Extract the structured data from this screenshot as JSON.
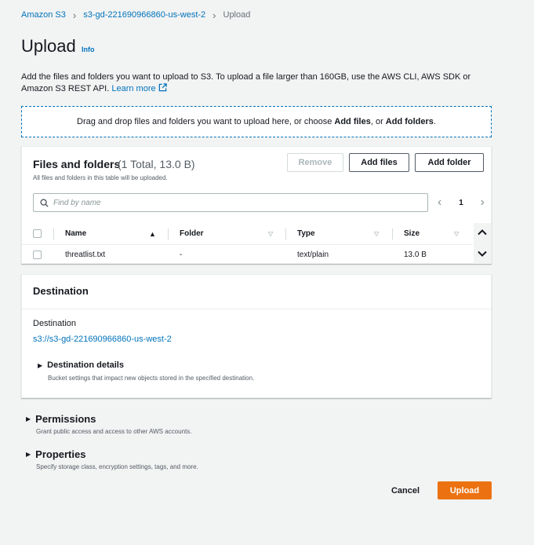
{
  "breadcrumb": {
    "items": [
      "Amazon S3",
      "s3-gd-221690966860-us-west-2",
      "Upload"
    ]
  },
  "page": {
    "title": "Upload",
    "info_label": "Info",
    "description": "Add the files and folders you want to upload to S3. To upload a file larger than 160GB, use the AWS CLI, AWS SDK or Amazon S3 REST API.",
    "learn_more": "Learn more"
  },
  "dropzone": {
    "text_prefix": "Drag and drop files and folders you want to upload here, or choose ",
    "add_files": "Add files",
    "text_mid": ", or ",
    "add_folders": "Add folders",
    "text_suffix": "."
  },
  "files_panel": {
    "title": "Files and folders",
    "count": "(1 Total, 13.0 B)",
    "subtitle": "All files and folders in this table will be uploaded.",
    "remove_label": "Remove",
    "add_files_label": "Add files",
    "add_folder_label": "Add folder",
    "search_placeholder": "Find by name",
    "page_number": "1",
    "columns": [
      "Name",
      "Folder",
      "Type",
      "Size"
    ],
    "rows": [
      {
        "name": "threatlist.txt",
        "folder": "-",
        "type": "text/plain",
        "size": "13.0 B"
      }
    ]
  },
  "destination": {
    "section_title": "Destination",
    "label": "Destination",
    "link": "s3://s3-gd-221690966860-us-west-2",
    "details_title": "Destination details",
    "details_sub": "Bucket settings that impact new objects stored in the specified destination."
  },
  "permissions": {
    "title": "Permissions",
    "sub": "Grant public access and access to other AWS accounts."
  },
  "properties": {
    "title": "Properties",
    "sub": "Specify storage class, encryption settings, tags, and more."
  },
  "footer": {
    "cancel_label": "Cancel",
    "upload_label": "Upload"
  },
  "colors": {
    "accent": "#ec7211",
    "link": "#0073bb",
    "background": "#f2f3f3"
  }
}
